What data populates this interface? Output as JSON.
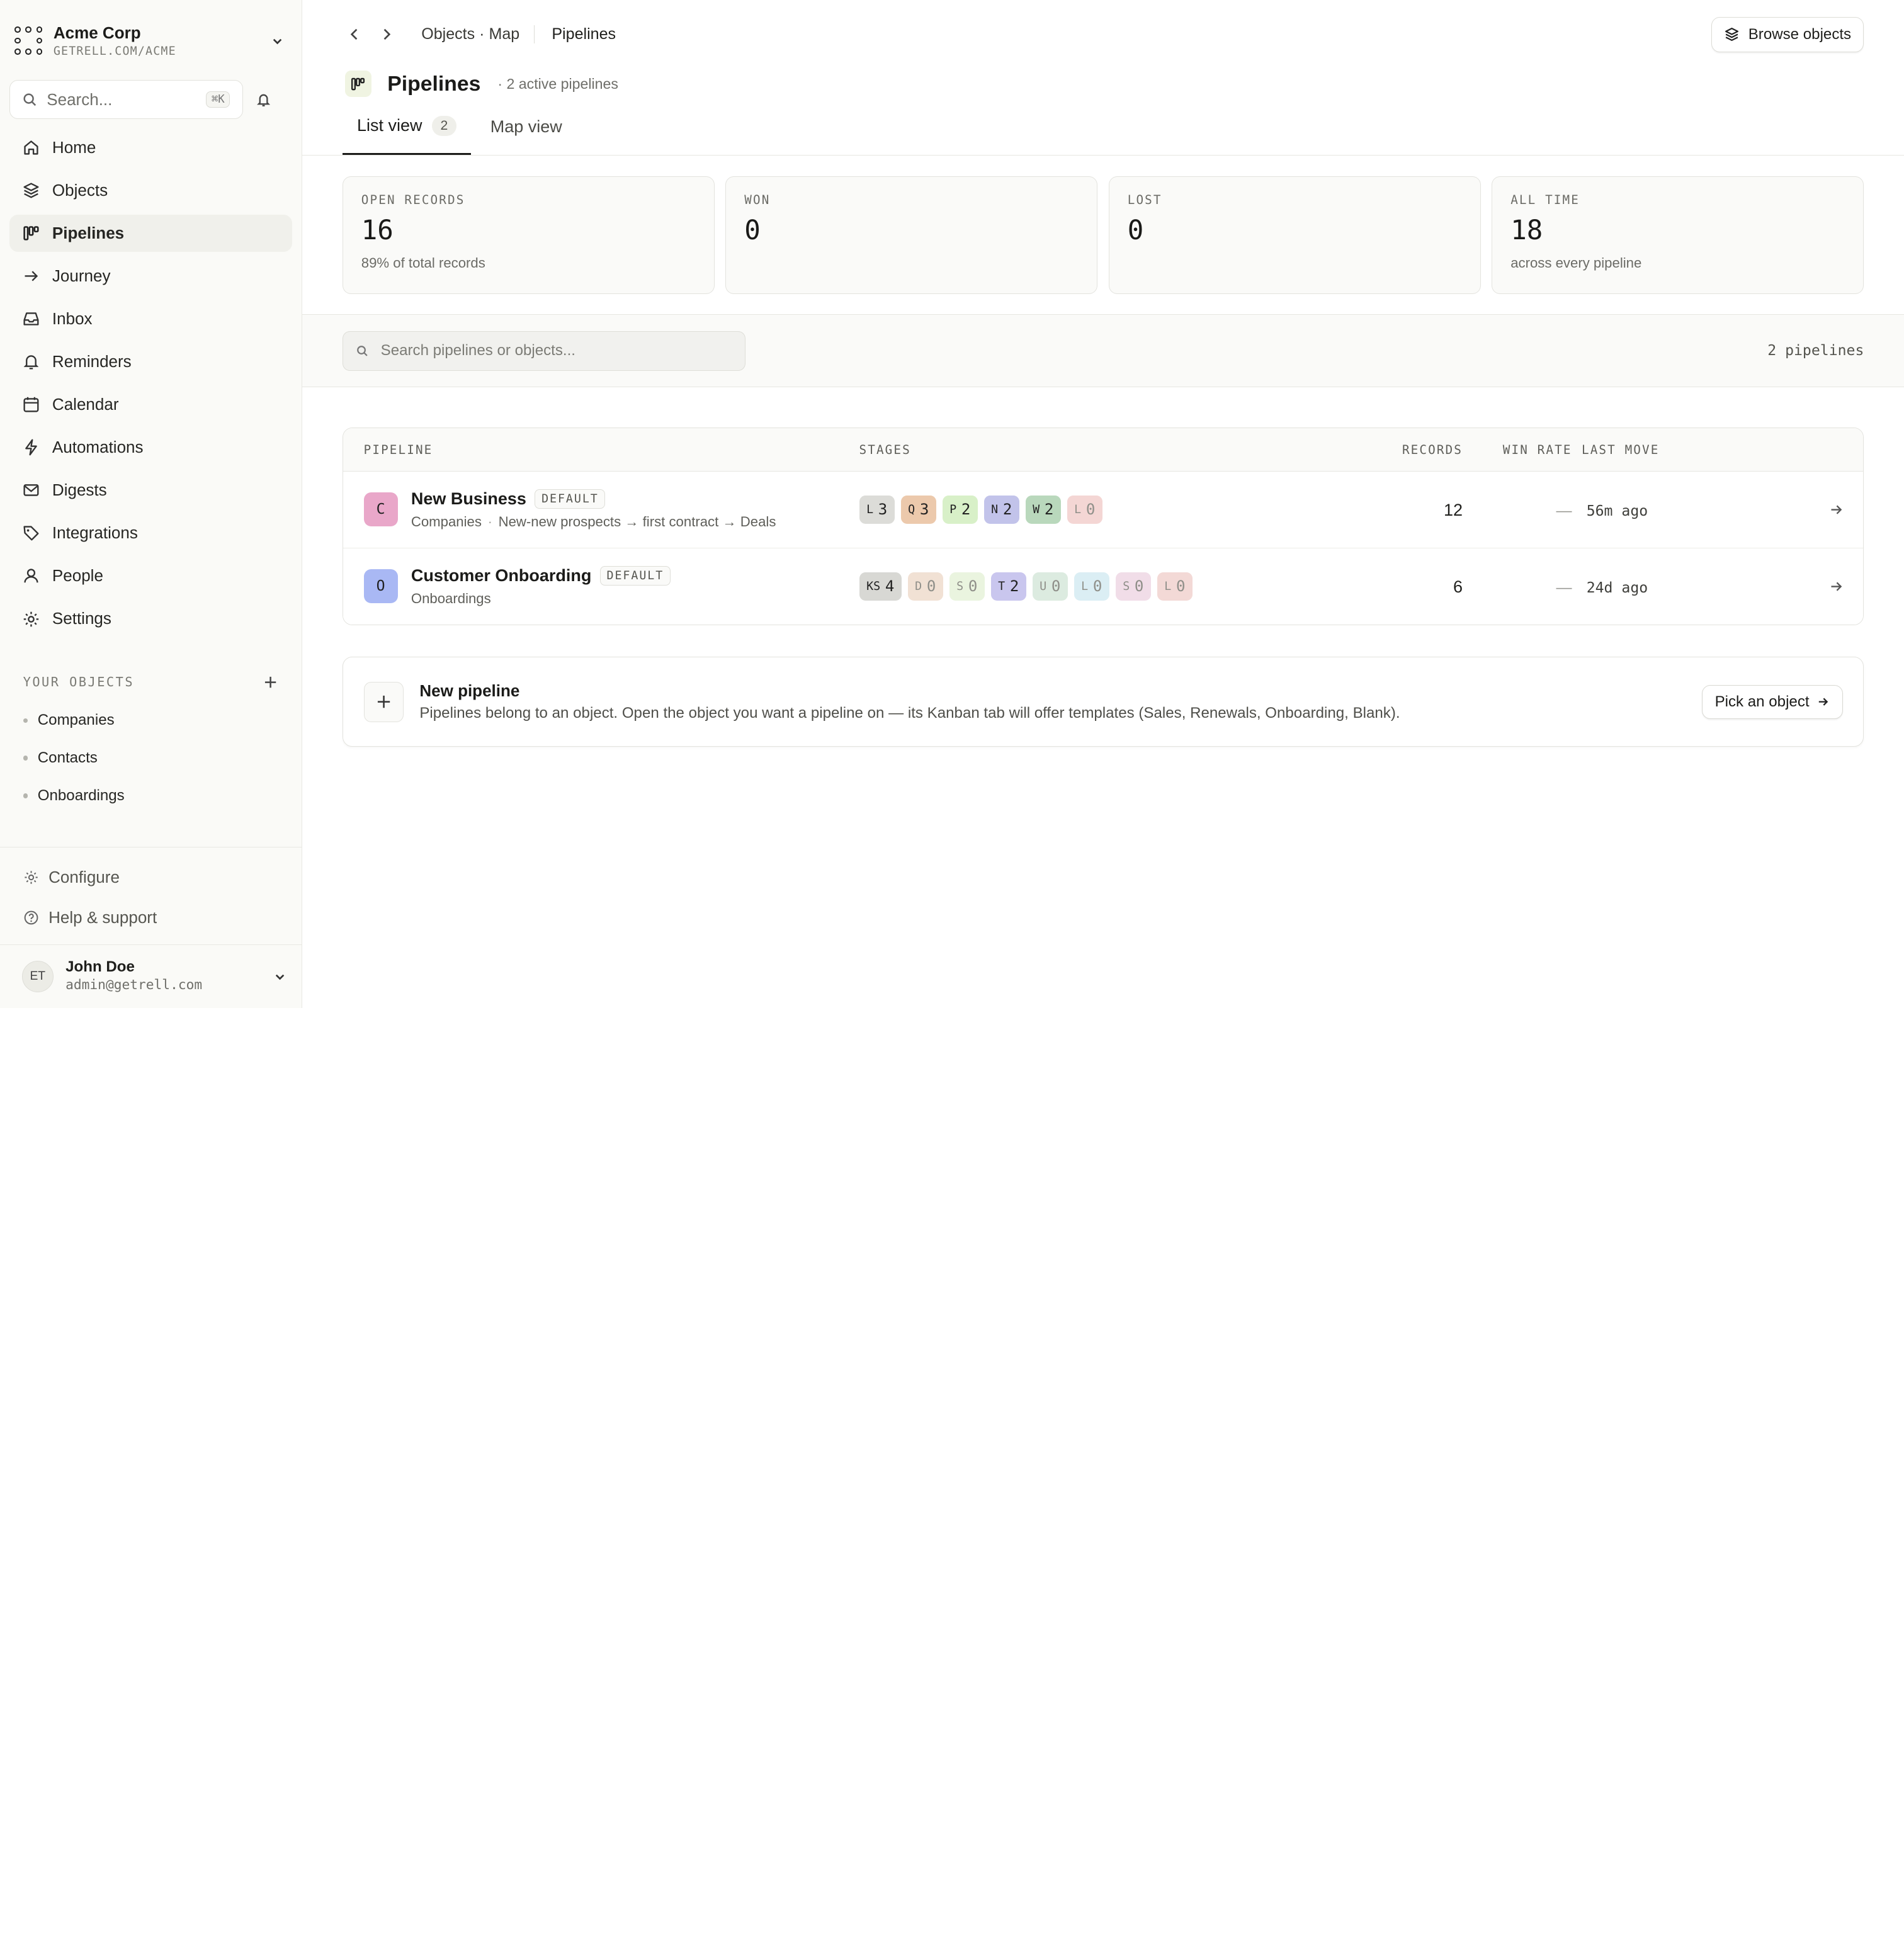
{
  "org": {
    "name": "Acme Corp",
    "url": "GETRELL.COM/ACME"
  },
  "search": {
    "placeholder": "Search...",
    "shortcut": "⌘K"
  },
  "nav": [
    {
      "label": "Home",
      "icon": "home-icon"
    },
    {
      "label": "Objects",
      "icon": "layers-icon"
    },
    {
      "label": "Pipelines",
      "icon": "pipeline-icon",
      "active": true
    },
    {
      "label": "Journey",
      "icon": "arrow-right-icon"
    },
    {
      "label": "Inbox",
      "icon": "inbox-icon"
    },
    {
      "label": "Reminders",
      "icon": "bell-icon"
    },
    {
      "label": "Calendar",
      "icon": "calendar-icon"
    },
    {
      "label": "Automations",
      "icon": "bolt-icon"
    },
    {
      "label": "Digests",
      "icon": "mail-icon"
    },
    {
      "label": "Integrations",
      "icon": "tag-icon"
    },
    {
      "label": "People",
      "icon": "user-icon"
    },
    {
      "label": "Settings",
      "icon": "gear-icon"
    }
  ],
  "your_objects": {
    "title": "YOUR OBJECTS",
    "items": [
      "Companies",
      "Contacts",
      "Onboardings"
    ]
  },
  "bottom": {
    "configure": "Configure",
    "help": "Help & support"
  },
  "user": {
    "initials": "ET",
    "name": "John Doe",
    "email": "admin@getrell.com"
  },
  "breadcrumb": {
    "parent": "Objects · Map",
    "current": "Pipelines"
  },
  "browse_button": "Browse objects",
  "page": {
    "title": "Pipelines",
    "subtitle": "· 2 active pipelines"
  },
  "tabs": [
    {
      "label": "List view",
      "count": "2",
      "active": true
    },
    {
      "label": "Map view"
    }
  ],
  "stats": [
    {
      "label": "OPEN RECORDS",
      "value": "16",
      "sub": "89% of total records"
    },
    {
      "label": "WON",
      "value": "0",
      "sub": ""
    },
    {
      "label": "LOST",
      "value": "0",
      "sub": ""
    },
    {
      "label": "ALL TIME",
      "value": "18",
      "sub": "across every pipeline"
    }
  ],
  "filter": {
    "placeholder": "Search pipelines or objects...",
    "count": "2 pipelines"
  },
  "table": {
    "headers": {
      "pipeline": "PIPELINE",
      "stages": "STAGES",
      "records": "RECORDS",
      "win_rate": "WIN RATE",
      "last_move": "LAST MOVE"
    },
    "rows": [
      {
        "badge": "C",
        "badge_color": "#e9a7c9",
        "name": "New Business",
        "tag": "DEFAULT",
        "object": "Companies",
        "description": "New-new prospects → first contract → Deals",
        "stages": [
          {
            "k": "L",
            "n": "3",
            "color": "#dcdcd8"
          },
          {
            "k": "Q",
            "n": "3",
            "color": "#ecc9ac"
          },
          {
            "k": "P",
            "n": "2",
            "color": "#d8f0c8"
          },
          {
            "k": "N",
            "n": "2",
            "color": "#c2c3ea"
          },
          {
            "k": "W",
            "n": "2",
            "color": "#b9d8bc"
          },
          {
            "k": "L",
            "n": "0",
            "color": "#f4d6d4"
          }
        ],
        "records": "12",
        "win_rate": "—",
        "last_move": "56m ago"
      },
      {
        "badge": "O",
        "badge_color": "#a9b8f4",
        "name": "Customer Onboarding",
        "tag": "DEFAULT",
        "object": "Onboardings",
        "description": "",
        "stages": [
          {
            "k": "KS",
            "n": "4",
            "color": "#d8d8d4"
          },
          {
            "k": "D",
            "n": "0",
            "color": "#f1e1d4"
          },
          {
            "k": "S",
            "n": "0",
            "color": "#eaf4df"
          },
          {
            "k": "T",
            "n": "2",
            "color": "#c9c6ee"
          },
          {
            "k": "U",
            "n": "0",
            "color": "#dcebe0"
          },
          {
            "k": "L",
            "n": "0",
            "color": "#dbeef4"
          },
          {
            "k": "S",
            "n": "0",
            "color": "#f1dde8"
          },
          {
            "k": "L",
            "n": "0",
            "color": "#f3d9d6"
          }
        ],
        "records": "6",
        "win_rate": "—",
        "last_move": "24d ago"
      }
    ]
  },
  "new_pipeline": {
    "title": "New pipeline",
    "description": "Pipelines belong to an object. Open the object you want a pipeline on — its Kanban tab will offer templates (Sales, Renewals, Onboarding, Blank).",
    "button": "Pick an object"
  }
}
